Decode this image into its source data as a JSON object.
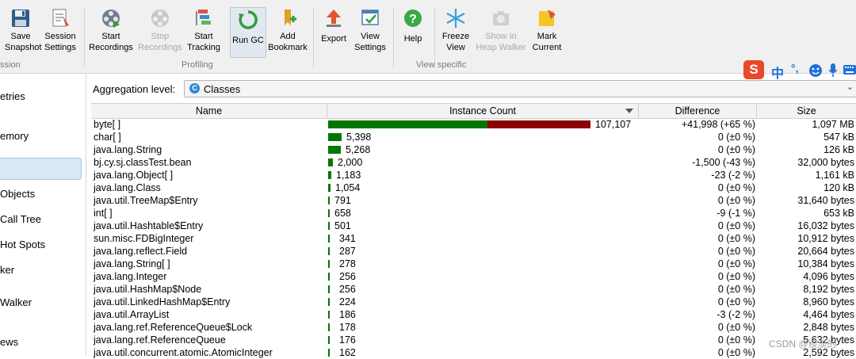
{
  "toolbar": {
    "buttons": [
      {
        "id": "save-snapshot",
        "label1": "Save",
        "label2": "Snapshot"
      },
      {
        "id": "session-settings",
        "label1": "Session",
        "label2": "Settings"
      },
      {
        "id": "start-recordings",
        "label1": "Start",
        "label2": "Recordings"
      },
      {
        "id": "stop-recordings",
        "label1": "Stop",
        "label2": "Recordings"
      },
      {
        "id": "start-tracking",
        "label1": "Start",
        "label2": "Tracking"
      },
      {
        "id": "run-gc",
        "label1": "Run GC",
        "label2": ""
      },
      {
        "id": "add-bookmark",
        "label1": "Add",
        "label2": "Bookmark"
      },
      {
        "id": "export",
        "label1": "Export",
        "label2": ""
      },
      {
        "id": "view-settings",
        "label1": "View",
        "label2": "Settings"
      },
      {
        "id": "help",
        "label1": "Help",
        "label2": ""
      },
      {
        "id": "freeze-view",
        "label1": "Freeze",
        "label2": "View"
      },
      {
        "id": "show-in-heap-walker",
        "label1": "Show In",
        "label2": "Heap Walker"
      },
      {
        "id": "mark-current",
        "label1": "Mark",
        "label2": "Current"
      }
    ],
    "groups": {
      "session": "ssion",
      "profiling": "Profiling",
      "view_specific": "View specific"
    }
  },
  "sidebar": {
    "items": [
      "etries",
      "emory",
      "Objects",
      "Call Tree",
      "Hot Spots",
      "ker",
      "Walker",
      "ews"
    ]
  },
  "aggregation": {
    "label": "Aggregation level:",
    "value": "Classes",
    "icon_letter": "C"
  },
  "table": {
    "headers": {
      "name": "Name",
      "count": "Instance Count",
      "diff": "Difference",
      "size": "Size"
    },
    "rows": [
      {
        "name": "byte[ ]",
        "count": "107,107",
        "count_value": 107107,
        "base_value": 65109,
        "diff": "+41,998 (+65 %)",
        "size": "1,097 MB"
      },
      {
        "name": "char[ ]",
        "count": "5,398",
        "count_value": 5398,
        "base_value": 5398,
        "diff": "0 (±0 %)",
        "size": "547 kB"
      },
      {
        "name": "java.lang.String",
        "count": "5,268",
        "count_value": 5268,
        "base_value": 5268,
        "diff": "0 (±0 %)",
        "size": "126 kB"
      },
      {
        "name": "bj.cy.sj.classTest.bean",
        "count": "2,000",
        "count_value": 2000,
        "base_value": 2000,
        "diff": "-1,500 (-43 %)",
        "size": "32,000 bytes"
      },
      {
        "name": "java.lang.Object[ ]",
        "count": "1,183",
        "count_value": 1183,
        "base_value": 1183,
        "diff": "-23 (-2 %)",
        "size": "1,161 kB"
      },
      {
        "name": "java.lang.Class",
        "count": "1,054",
        "count_value": 1054,
        "base_value": 1054,
        "diff": "0 (±0 %)",
        "size": "120 kB"
      },
      {
        "name": "java.util.TreeMap$Entry",
        "count": "791",
        "count_value": 791,
        "base_value": 791,
        "diff": "0 (±0 %)",
        "size": "31,640 bytes"
      },
      {
        "name": "int[ ]",
        "count": "658",
        "count_value": 658,
        "base_value": 658,
        "diff": "-9 (-1 %)",
        "size": "653 kB"
      },
      {
        "name": "java.util.Hashtable$Entry",
        "count": "501",
        "count_value": 501,
        "base_value": 501,
        "diff": "0 (±0 %)",
        "size": "16,032 bytes"
      },
      {
        "name": "sun.misc.FDBigInteger",
        "count": "341",
        "count_value": 341,
        "base_value": 341,
        "diff": "0 (±0 %)",
        "size": "10,912 bytes"
      },
      {
        "name": "java.lang.reflect.Field",
        "count": "287",
        "count_value": 287,
        "base_value": 287,
        "diff": "0 (±0 %)",
        "size": "20,664 bytes"
      },
      {
        "name": "java.lang.String[ ]",
        "count": "278",
        "count_value": 278,
        "base_value": 278,
        "diff": "0 (±0 %)",
        "size": "10,384 bytes"
      },
      {
        "name": "java.lang.Integer",
        "count": "256",
        "count_value": 256,
        "base_value": 256,
        "diff": "0 (±0 %)",
        "size": "4,096 bytes"
      },
      {
        "name": "java.util.HashMap$Node",
        "count": "256",
        "count_value": 256,
        "base_value": 256,
        "diff": "0 (±0 %)",
        "size": "8,192 bytes"
      },
      {
        "name": "java.util.LinkedHashMap$Entry",
        "count": "224",
        "count_value": 224,
        "base_value": 224,
        "diff": "0 (±0 %)",
        "size": "8,960 bytes"
      },
      {
        "name": "java.util.ArrayList",
        "count": "186",
        "count_value": 186,
        "base_value": 186,
        "diff": "-3 (-2 %)",
        "size": "4,464 bytes"
      },
      {
        "name": "java.lang.ref.ReferenceQueue$Lock",
        "count": "178",
        "count_value": 178,
        "base_value": 178,
        "diff": "0 (±0 %)",
        "size": "2,848 bytes"
      },
      {
        "name": "java.lang.ref.ReferenceQueue",
        "count": "176",
        "count_value": 176,
        "base_value": 176,
        "diff": "0 (±0 %)",
        "size": "5,632 bytes"
      },
      {
        "name": "java.util.concurrent.atomic.AtomicInteger",
        "count": "162",
        "count_value": 162,
        "base_value": 162,
        "diff": "0 (±0 %)",
        "size": "2,592 bytes"
      }
    ]
  },
  "colors": {
    "bar_base": "#007700",
    "bar_increase": "#8b0000",
    "selected_bg": "#dbe8f5"
  },
  "ime": {
    "brand": "S",
    "lang": "中"
  },
  "watermark": "CSDN @淡淡的"
}
